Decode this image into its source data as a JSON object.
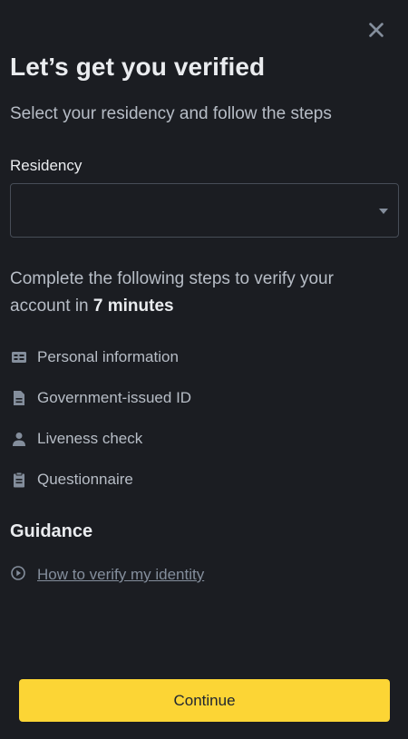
{
  "header": {
    "title": "Let’s get you verified",
    "subtitle": "Select your residency and follow the steps"
  },
  "residency": {
    "label": "Residency",
    "selected_value": ""
  },
  "steps_intro": {
    "text": "Complete the following steps to verify your account in ",
    "duration": "7 minutes"
  },
  "steps": [
    {
      "icon": "id-card-icon",
      "label": "Personal information"
    },
    {
      "icon": "document-icon",
      "label": "Government-issued ID"
    },
    {
      "icon": "person-icon",
      "label": "Liveness check"
    },
    {
      "icon": "clipboard-icon",
      "label": "Questionnaire"
    }
  ],
  "guidance": {
    "title": "Guidance",
    "link_icon": "play-circle-icon",
    "link_label": "How to verify my identity"
  },
  "footer": {
    "continue_label": "Continue"
  },
  "colors": {
    "background": "#1b1d22",
    "primary_button": "#fcd535",
    "text_primary": "#eaecef",
    "text_secondary": "#b7bdc6",
    "icon": "#848e9c"
  }
}
